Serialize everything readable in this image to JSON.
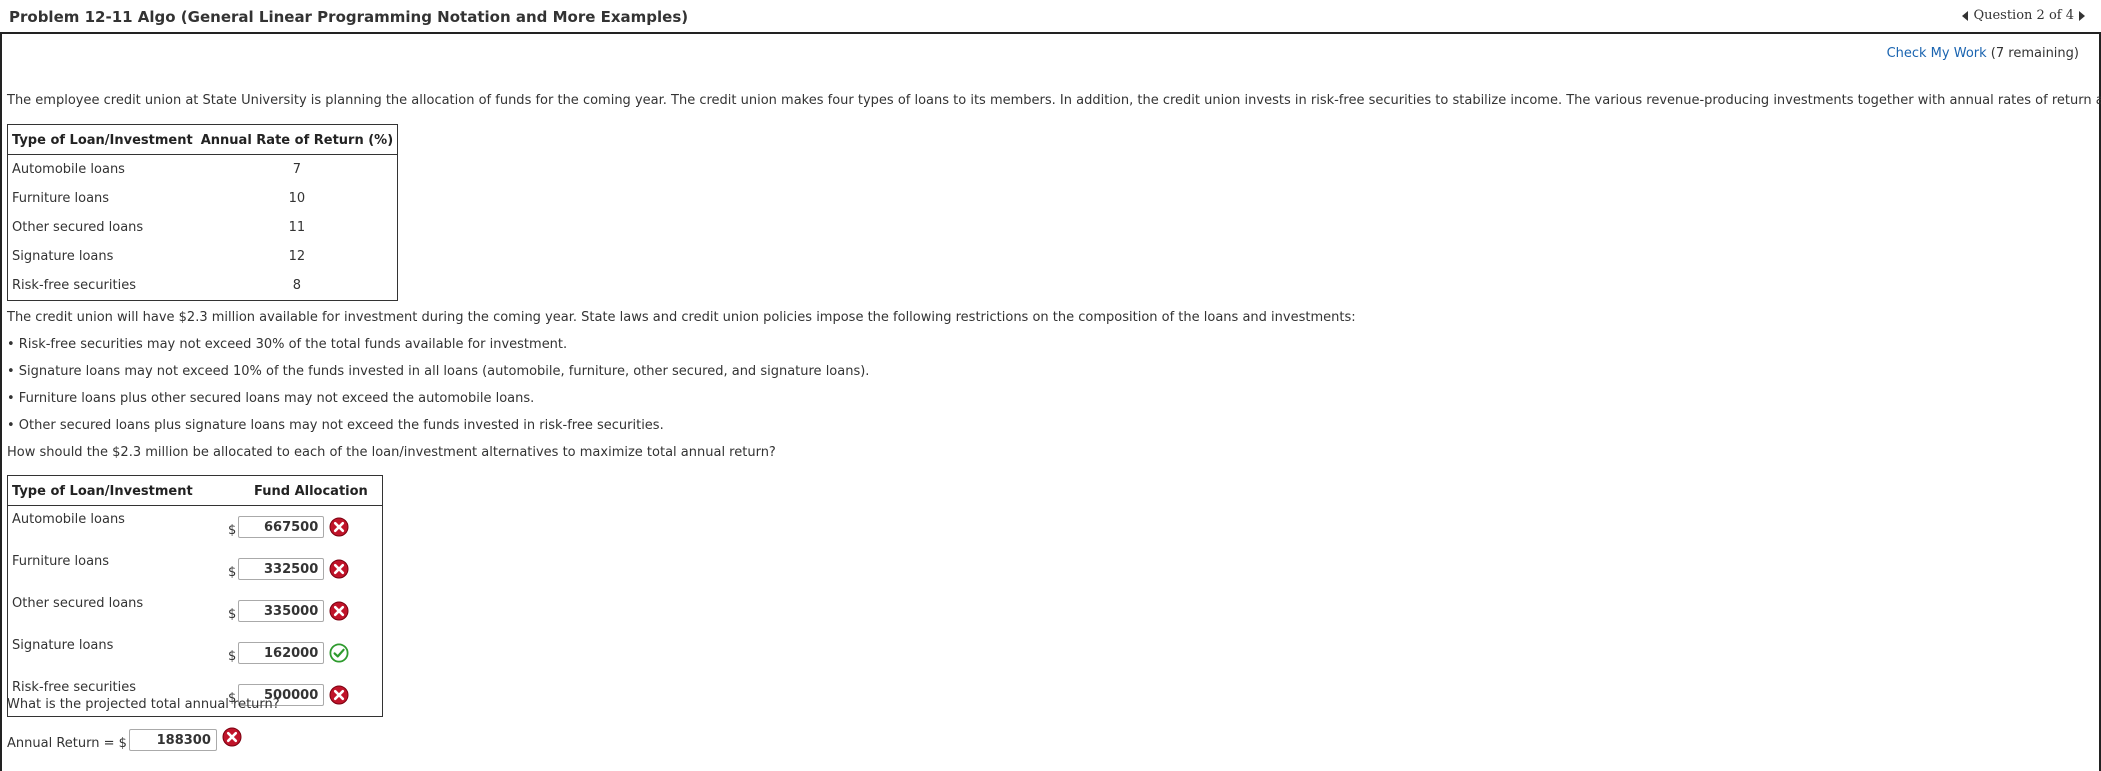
{
  "header": {
    "title": "Problem 12-11 Algo (General Linear Programming Notation and More Examples)",
    "question_nav": "Question 2 of 4"
  },
  "check": {
    "link": "Check My Work",
    "remaining": "(7 remaining)"
  },
  "intro": "The employee credit union at State University is planning the allocation of funds for the coming year. The credit union makes four types of loans to its members. In addition, the credit union invests in risk-free securities to stabilize income. The various revenue-producing investments together with annual rates of return are as follows:",
  "rates_table": {
    "headers": [
      "Type of Loan/Investment",
      "Annual Rate of Return (%)"
    ],
    "rows": [
      [
        "Automobile loans",
        "7"
      ],
      [
        "Furniture loans",
        "10"
      ],
      [
        "Other secured loans",
        "11"
      ],
      [
        "Signature loans",
        "12"
      ],
      [
        "Risk-free securities",
        "8"
      ]
    ]
  },
  "restrictions_intro": "The credit union will have $2.3 million available for investment during the coming year. State laws and credit union policies impose the following restrictions on the composition of the loans and investments:",
  "restrictions": [
    "• Risk-free securities may not exceed 30% of the total funds available for investment.",
    "• Signature loans may not exceed 10% of the funds invested in all loans (automobile, furniture, other secured, and signature loans).",
    "• Furniture loans plus other secured loans may not exceed the automobile loans.",
    "• Other secured loans plus signature loans may not exceed the funds invested in risk-free securities."
  ],
  "question": "How should the $2.3 million be allocated to each of the loan/investment alternatives to maximize total annual return?",
  "alloc_table": {
    "headers": [
      "Type of Loan/Investment",
      "Fund Allocation"
    ],
    "currency": "$",
    "rows": [
      {
        "label": "Automobile loans",
        "value": "667500",
        "status": "incorrect"
      },
      {
        "label": "Furniture loans",
        "value": "332500",
        "status": "incorrect"
      },
      {
        "label": "Other secured loans",
        "value": "335000",
        "status": "incorrect"
      },
      {
        "label": "Signature loans",
        "value": "162000",
        "status": "correct"
      },
      {
        "label": "Risk-free securities",
        "value": "500000",
        "status": "incorrect"
      }
    ]
  },
  "return_question": "What is the projected total annual return?",
  "annual_return": {
    "label": "Annual Return = $",
    "value": "188300",
    "status": "incorrect"
  },
  "colors": {
    "incorrect": "#c0142a",
    "correct": "#2e9b2e",
    "link": "#1a64b0"
  }
}
